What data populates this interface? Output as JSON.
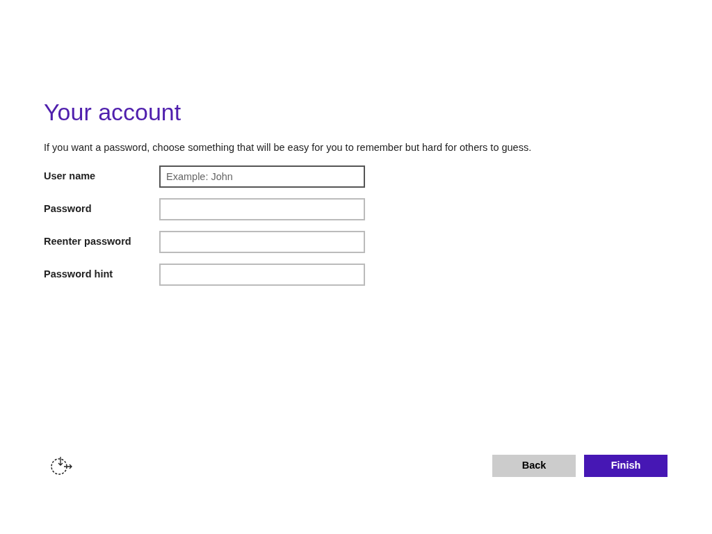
{
  "title": "Your account",
  "description": "If you want a password, choose something that will be easy for you to remember but hard for others to guess.",
  "fields": [
    {
      "label": "User name",
      "placeholder": "Example: John",
      "focused": true
    },
    {
      "label": "Password",
      "focused": false
    },
    {
      "label": "Reenter password",
      "focused": false
    },
    {
      "label": "Password hint",
      "focused": false
    }
  ],
  "buttons": [
    {
      "label": "Back",
      "kind": "secondary"
    },
    {
      "label": "Finish",
      "kind": "primary"
    }
  ]
}
